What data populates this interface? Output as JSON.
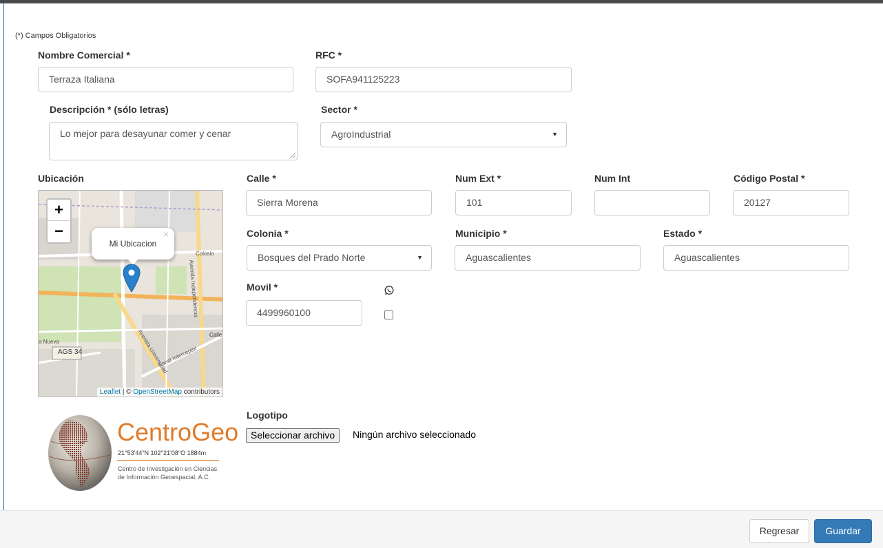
{
  "required_note": "(*) Campos Obligatorios",
  "form": {
    "nombre_comercial": {
      "label": "Nombre Comercial *",
      "value": "Terraza Italiana"
    },
    "rfc": {
      "label": "RFC *",
      "value": "SOFA941125223"
    },
    "descripcion": {
      "label": "Descripción * (sólo letras)",
      "value": "Lo mejor para desayunar comer y cenar"
    },
    "sector": {
      "label": "Sector *",
      "value": "AgroIndustrial"
    },
    "ubicacion": {
      "label": "Ubicación"
    },
    "calle": {
      "label": "Calle *",
      "value": "Sierra Morena"
    },
    "num_ext": {
      "label": "Num Ext *",
      "value": "101"
    },
    "num_int": {
      "label": "Num Int",
      "value": ""
    },
    "codigo_postal": {
      "label": "Código Postal *",
      "value": "20127"
    },
    "colonia": {
      "label": "Colonia *",
      "value": "Bosques del Prado Norte"
    },
    "municipio": {
      "label": "Municipio *",
      "value": "Aguascalientes"
    },
    "estado": {
      "label": "Estado *",
      "value": "Aguascalientes"
    },
    "movil": {
      "label": "Movil *",
      "value": "4499960100"
    },
    "logotipo": {
      "label": "Logotipo",
      "button": "Seleccionar archivo",
      "status": "Ningún archivo seleccionado"
    }
  },
  "map": {
    "zoom_in": "+",
    "zoom_out": "−",
    "popup_text": "Mi Ubicacion",
    "popup_close": "×",
    "attribution_leaflet": "Leaflet",
    "attribution_sep": " | © ",
    "attribution_osm": "OpenStreetMap",
    "attribution_tail": " contributors",
    "street_labels": [
      "AGS 34",
      "Calle",
      "Avenida Independencia",
      "Avenida Universidad",
      "Canal Interceptor",
      "Colosio",
      "a Nueva"
    ]
  },
  "logo": {
    "name_part1": "Centro",
    "name_part2": "Geo",
    "coords": "21°53'44\"N 102°21'08\"O 1884m",
    "desc_line1": "Centro de Investigación en Ciencias",
    "desc_line2": "de Información Geoespacial, A.C."
  },
  "footer": {
    "back_label": "Regresar",
    "save_label": "Guardar"
  },
  "colors": {
    "primary": "#337ab7",
    "logo_orange": "#e07b2a",
    "marker": "#2a81cb"
  },
  "icons": {
    "whatsapp": "whatsapp-icon",
    "marker": "map-marker-icon"
  }
}
